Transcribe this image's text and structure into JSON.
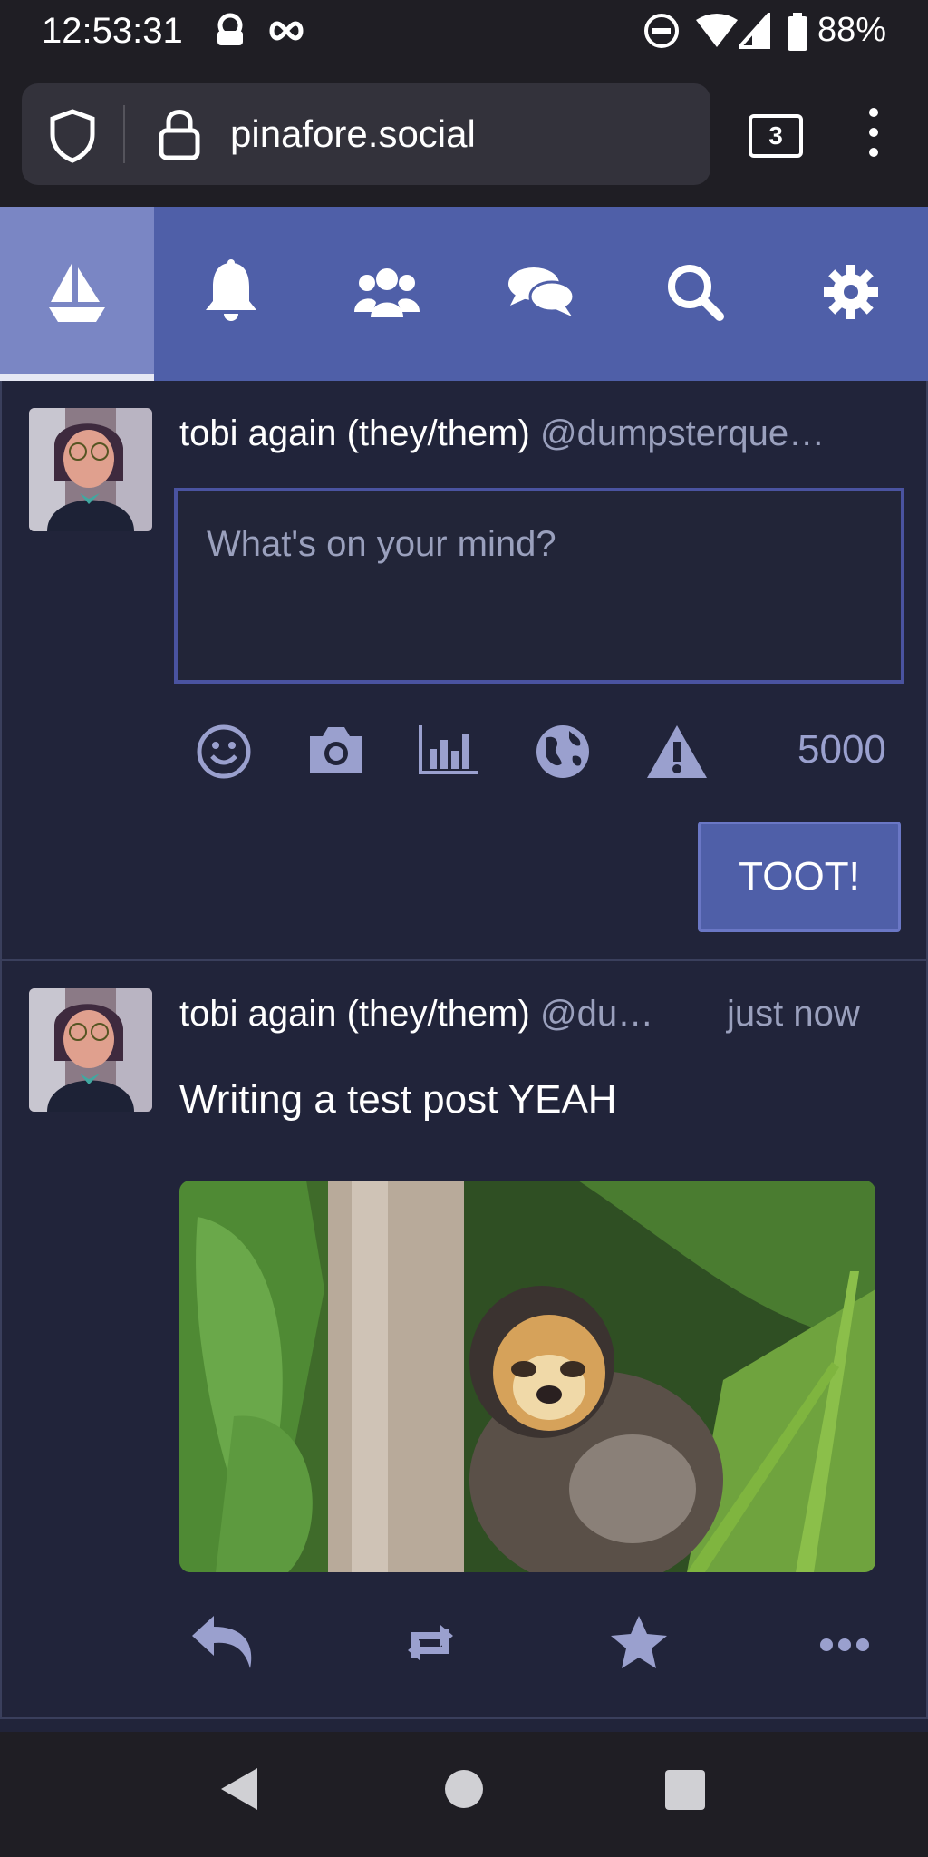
{
  "status_bar": {
    "time": "12:53:31",
    "battery": "88%",
    "icons": [
      "vpn-lock-icon",
      "infinity-icon",
      "do-not-disturb-icon",
      "wifi-icon",
      "signal-icon",
      "battery-icon"
    ]
  },
  "browser": {
    "url": "pinafore.social",
    "tab_count": "3",
    "icons": [
      "shield-icon",
      "lock-icon",
      "menu-dots-icon"
    ]
  },
  "app_nav": {
    "items": [
      {
        "name": "home",
        "icon": "sailboat-icon",
        "active": true
      },
      {
        "name": "notifications",
        "icon": "bell-icon"
      },
      {
        "name": "community",
        "icon": "users-icon"
      },
      {
        "name": "conversations",
        "icon": "comments-icon"
      },
      {
        "name": "search",
        "icon": "search-icon"
      },
      {
        "name": "settings",
        "icon": "gear-icon"
      }
    ]
  },
  "compose": {
    "display_name": "tobi again (they/them)",
    "handle": "@dumpsterque…",
    "placeholder": "What's on your mind?",
    "char_count": "5000",
    "toot_label": "TOOT!",
    "tools": [
      "emoji-icon",
      "camera-icon",
      "poll-icon",
      "globe-icon",
      "warning-icon"
    ]
  },
  "post": {
    "display_name": "tobi again (they/them)",
    "handle": "@du…",
    "time": "just now",
    "content": "Writing a test post YEAH",
    "actions": [
      "reply-icon",
      "boost-icon",
      "favorite-icon",
      "more-icon"
    ]
  },
  "colors": {
    "accent": "#4f5fa8",
    "active_nav": "#7a86c4",
    "background": "#21243a",
    "icon_muted": "#9aa0ce"
  }
}
